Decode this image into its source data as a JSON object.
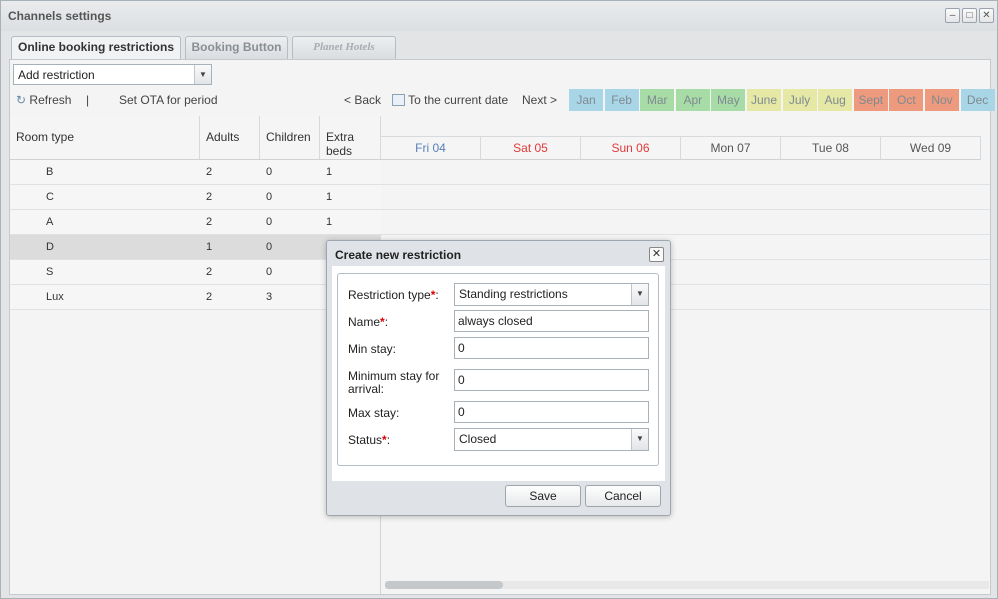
{
  "window": {
    "title": "Channels settings"
  },
  "tabs": [
    {
      "label": "Online booking restrictions"
    },
    {
      "label": "Booking Button"
    },
    {
      "label": "Planet Hotels"
    }
  ],
  "add_restriction": {
    "value": "Add restriction"
  },
  "toolbar": {
    "refresh": "Refresh",
    "separator": "|",
    "set_ota": "Set OTA for period",
    "back": "< Back",
    "current_date": "To the current date",
    "next": "Next >"
  },
  "months": [
    {
      "label": "Jan",
      "color": "#a9d6e6"
    },
    {
      "label": "Feb",
      "color": "#a9d6e6"
    },
    {
      "label": "Mar",
      "color": "#a8dca6"
    },
    {
      "label": "Apr",
      "color": "#a8dca6"
    },
    {
      "label": "May",
      "color": "#a8dca6"
    },
    {
      "label": "June",
      "color": "#e6e8a6"
    },
    {
      "label": "July",
      "color": "#e6e8a6"
    },
    {
      "label": "Aug",
      "color": "#e6e8a6"
    },
    {
      "label": "Sept",
      "color": "#ee9a7e"
    },
    {
      "label": "Oct",
      "color": "#ee9a7e"
    },
    {
      "label": "Nov",
      "color": "#ee9a7e"
    },
    {
      "label": "Dec",
      "color": "#a9d6e6"
    }
  ],
  "grid": {
    "columns": [
      "Room type",
      "Adults",
      "Children",
      "Extra beds"
    ],
    "rows": [
      {
        "room": "B",
        "adults": "2",
        "children": "0",
        "extra": "1"
      },
      {
        "room": "C",
        "adults": "2",
        "children": "0",
        "extra": "1"
      },
      {
        "room": "A",
        "adults": "2",
        "children": "0",
        "extra": "1"
      },
      {
        "room": "D",
        "adults": "1",
        "children": "0",
        "extra": ""
      },
      {
        "room": "S",
        "adults": "2",
        "children": "0",
        "extra": ""
      },
      {
        "room": "Lux",
        "adults": "2",
        "children": "3",
        "extra": ""
      }
    ],
    "days": [
      {
        "label": "Fri 04",
        "color": "#5a7fb8"
      },
      {
        "label": "Sat 05",
        "color": "#e03a3a"
      },
      {
        "label": "Sun 06",
        "color": "#e03a3a"
      },
      {
        "label": "Mon 07",
        "color": "#555555"
      },
      {
        "label": "Tue 08",
        "color": "#555555"
      },
      {
        "label": "Wed 09",
        "color": "#555555"
      }
    ]
  },
  "dialog": {
    "title": "Create new restriction",
    "restriction_type_label": "Restriction type",
    "restriction_type_value": "Standing restrictions",
    "name_label": "Name",
    "name_value": "always closed",
    "min_stay_label": "Min stay:",
    "min_stay_value": "0",
    "min_arrival_label_1": "Minimum stay for",
    "min_arrival_label_2": "arrival:",
    "min_arrival_value": "0",
    "max_stay_label": "Max stay:",
    "max_stay_value": "0",
    "status_label": "Status",
    "status_value": "Closed",
    "required_mark": "*",
    "colon": ":",
    "save": "Save",
    "cancel": "Cancel"
  }
}
